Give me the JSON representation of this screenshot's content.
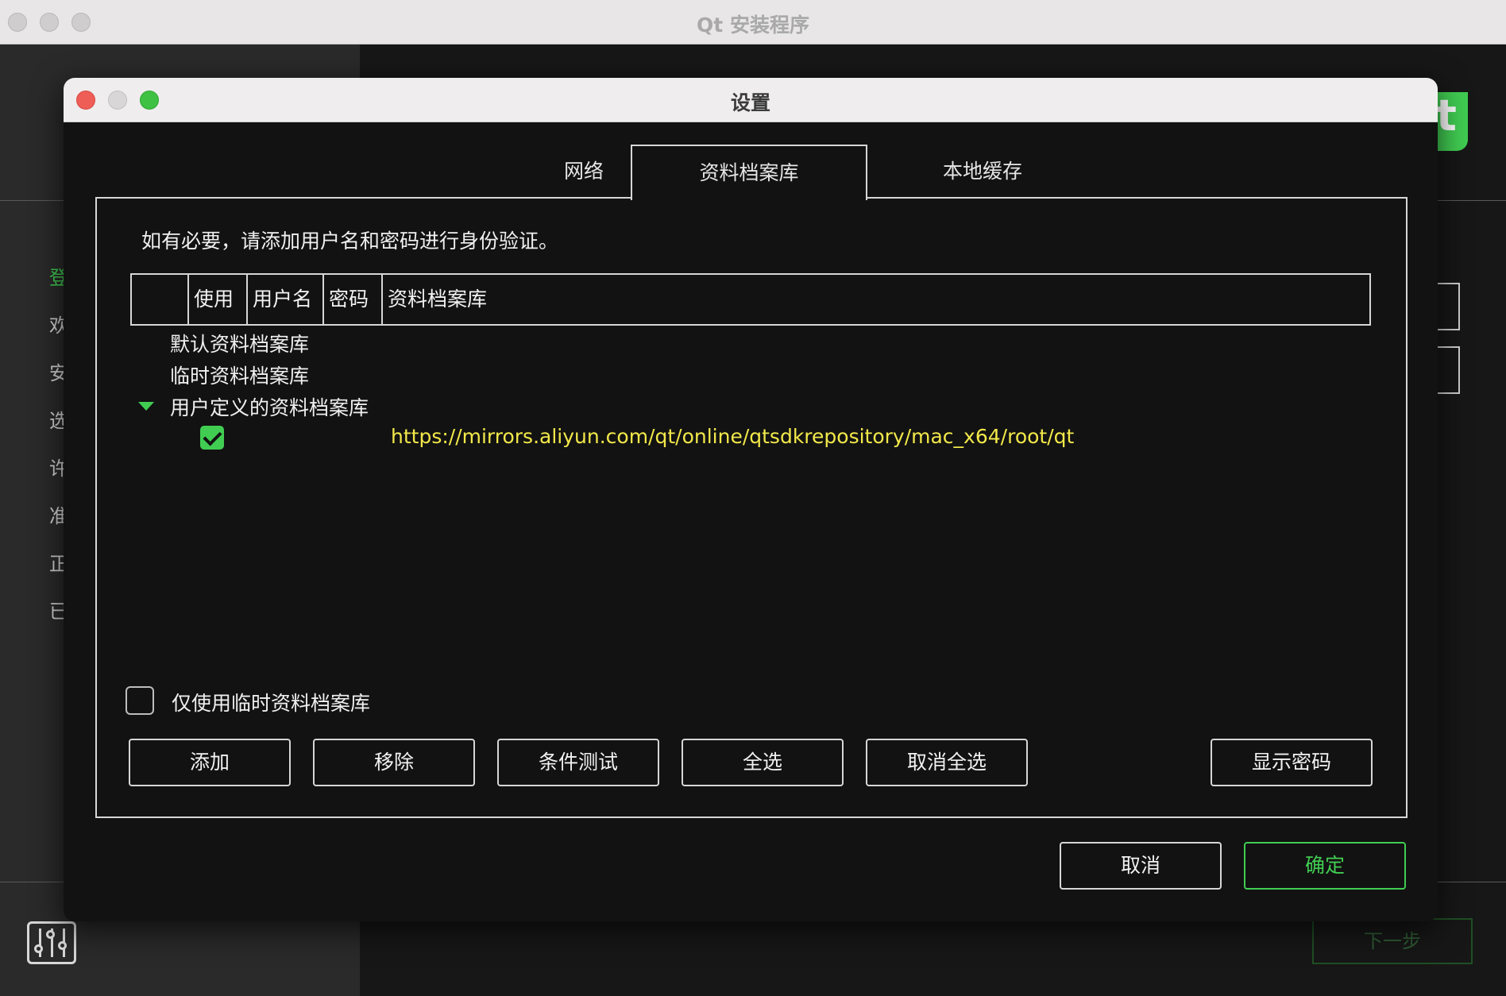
{
  "background_window": {
    "title": "Qt 安装程序",
    "sidebar_steps": [
      "登",
      "欢",
      "安",
      "选",
      "许",
      "准",
      "正",
      "已"
    ],
    "logo_glyph": "t",
    "next_button_label": "下一步",
    "settings_icon": "sliders-icon"
  },
  "dialog": {
    "title": "设置",
    "tabs": [
      {
        "label": "网络",
        "active": false
      },
      {
        "label": "资料档案库",
        "active": true
      },
      {
        "label": "本地缓存",
        "active": false
      }
    ],
    "instruction": "如有必要，请添加用户名和密码进行身份验证。",
    "table": {
      "headers": [
        "",
        "使用",
        "用户名",
        "密码",
        "资料档案库"
      ],
      "rows": {
        "default_repos": "默认资料档案库",
        "temp_repos": "临时资料档案库",
        "user_defined_repos": "用户定义的资料档案库",
        "user_repo_url": "https://mirrors.aliyun.com/qt/online/qtsdkrepository/mac_x64/root/qt",
        "user_repo_checked": true
      }
    },
    "only_temp_checkbox": {
      "label": "仅使用临时资料档案库",
      "checked": false
    },
    "buttons": {
      "add": "添加",
      "remove": "移除",
      "test": "条件测试",
      "select_all": "全选",
      "deselect_all": "取消全选",
      "show_passwords": "显示密码"
    },
    "footer": {
      "cancel": "取消",
      "ok": "确定"
    }
  },
  "colors": {
    "accent": "#41cd52",
    "url_text": "#f2e84a",
    "dialog_bg": "#121212",
    "close_light": "#ee5e57",
    "minimize_light": "#d8d6d6",
    "zoom_light": "#3fc144"
  }
}
